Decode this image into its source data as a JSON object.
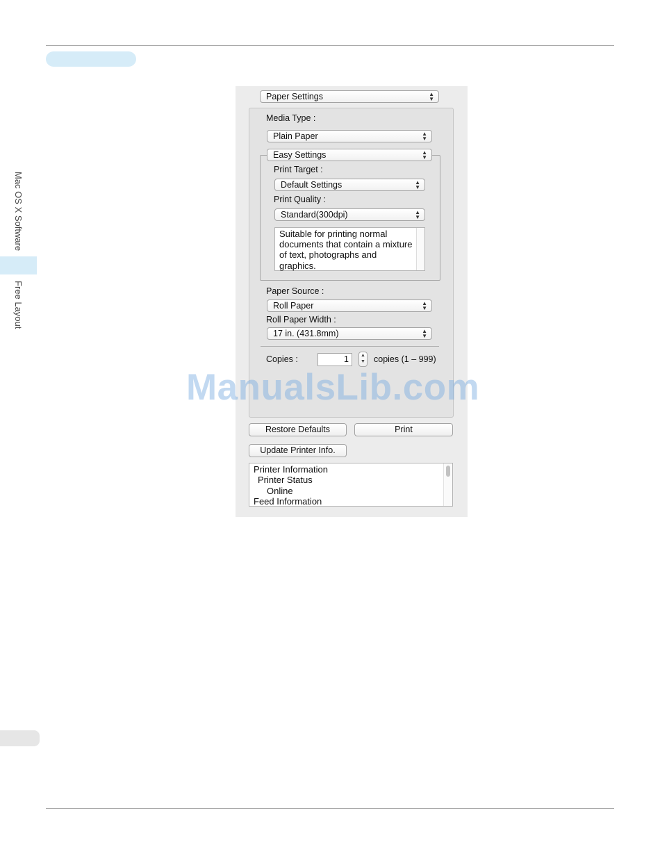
{
  "side_nav": {
    "section_label": "Mac OS X Software",
    "subsection_label": "Free Layout"
  },
  "dialog": {
    "panel_selector": "Paper Settings",
    "media_type": {
      "label": "Media Type :",
      "value": "Plain Paper"
    },
    "settings_mode": "Easy Settings",
    "print_target": {
      "label": "Print Target :",
      "value": "Default Settings"
    },
    "print_quality": {
      "label": "Print Quality :",
      "value": "Standard(300dpi)"
    },
    "quality_description": "Suitable for printing normal documents that contain a mixture of text, photographs and graphics.",
    "paper_source": {
      "label": "Paper Source :",
      "value": "Roll Paper"
    },
    "roll_paper_width": {
      "label": "Roll Paper Width :",
      "value": "17 in. (431.8mm)"
    },
    "copies": {
      "label": "Copies :",
      "value": "1",
      "range_text": "copies (1 – 999)"
    },
    "buttons": {
      "restore_defaults": "Restore Defaults",
      "print": "Print",
      "update_printer_info": "Update Printer Info."
    },
    "printer_info": {
      "lines": [
        "Printer Information",
        "Printer Status",
        "Online",
        "Feed Information"
      ]
    }
  },
  "watermark": "ManualsLib.com",
  "colors": {
    "accent_tab": "#d6ecf8",
    "panel_bg": "#ececec"
  }
}
